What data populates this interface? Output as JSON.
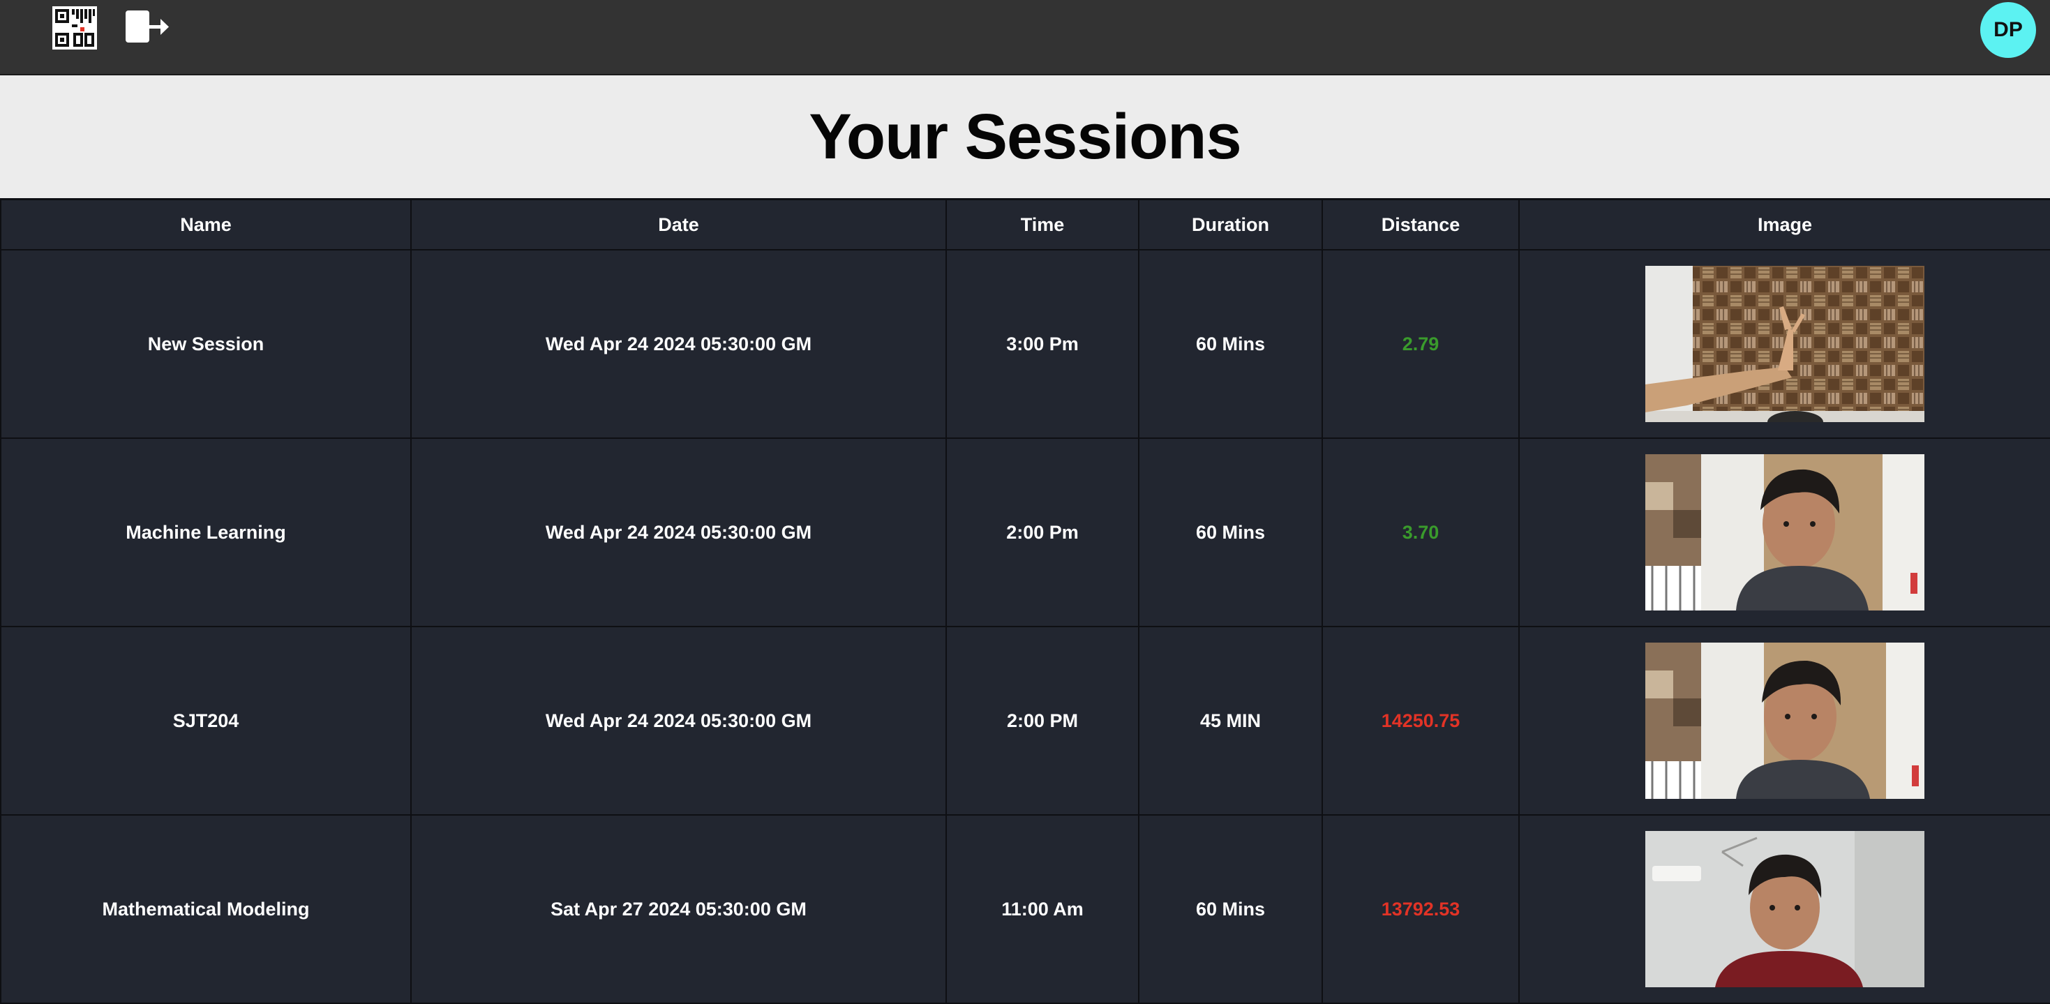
{
  "header": {
    "qr_icon": "qr-code-icon",
    "logout_icon": "logout-icon",
    "avatar_initials": "DP",
    "avatar_color": "#5cf2f2"
  },
  "page": {
    "title": "Your Sessions"
  },
  "table": {
    "columns": [
      "Name",
      "Date",
      "Time",
      "Duration",
      "Distance",
      "Image"
    ],
    "rows": [
      {
        "name": "New Session",
        "date": "Wed Apr 24 2024 05:30:00 GM",
        "time": "3:00 Pm",
        "duration": "60 Mins",
        "distance": "2.79",
        "distance_status": "ok",
        "image_desc": "raised-hand-photo"
      },
      {
        "name": "Machine Learning",
        "date": "Wed Apr 24 2024 05:30:00 GM",
        "time": "2:00 Pm",
        "duration": "60 Mins",
        "distance": "3.70",
        "distance_status": "ok",
        "image_desc": "selfie-photo"
      },
      {
        "name": "SJT204",
        "date": "Wed Apr 24 2024 05:30:00 GM",
        "time": "2:00 PM",
        "duration": "45 MIN",
        "distance": "14250.75",
        "distance_status": "bad",
        "image_desc": "selfie-photo"
      },
      {
        "name": "Mathematical Modeling",
        "date": "Sat Apr 27 2024 05:30:00 GM",
        "time": "11:00 Am",
        "duration": "60 Mins",
        "distance": "13792.53",
        "distance_status": "bad",
        "image_desc": "selfie-photo-red-shirt"
      }
    ]
  },
  "colors": {
    "topbar": "#333333",
    "title_band": "#ececec",
    "table_bg": "#222630",
    "distance_ok": "#3a9b2c",
    "distance_bad": "#e23326"
  }
}
